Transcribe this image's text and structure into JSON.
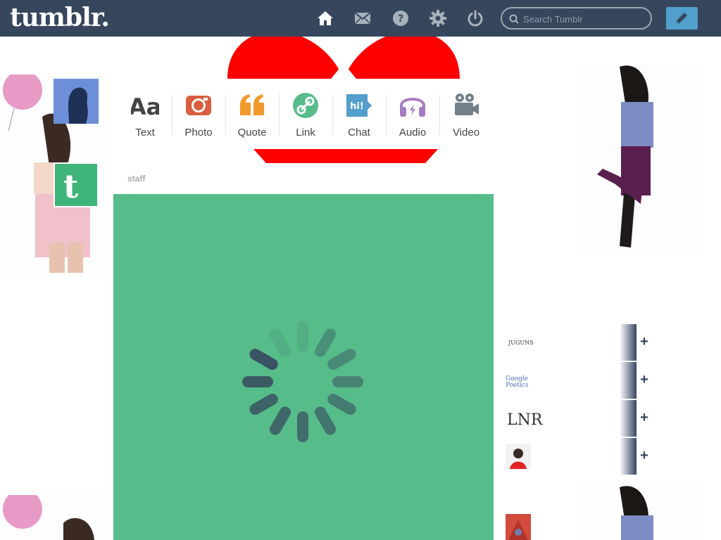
{
  "header": {
    "logo": "tumblr.",
    "search_placeholder": "Search Tumblr",
    "icons": [
      "home-icon",
      "mail-icon",
      "help-icon",
      "gear-icon",
      "power-icon"
    ],
    "compose_icon": "pencil-icon"
  },
  "post_types": [
    {
      "label": "Text",
      "icon": "text-icon",
      "color": "#444444"
    },
    {
      "label": "Photo",
      "icon": "camera-icon",
      "color": "#d95e40"
    },
    {
      "label": "Quote",
      "icon": "quote-icon",
      "color": "#f2992e"
    },
    {
      "label": "Link",
      "icon": "link-icon",
      "color": "#56bc8a"
    },
    {
      "label": "Chat",
      "icon": "chat-icon",
      "color": "#529ecc"
    },
    {
      "label": "Audio",
      "icon": "headphones-icon",
      "color": "#a77dc2"
    },
    {
      "label": "Video",
      "icon": "video-camera-icon",
      "color": "#748089"
    }
  ],
  "dashboard": {
    "post_author": "staff",
    "post_color": "#56bc8a"
  },
  "recommended": [
    {
      "thumb_text": "JUGUNS",
      "icon": "blog-avatar"
    },
    {
      "thumb_text": "Google Poetics",
      "icon": "blog-avatar"
    },
    {
      "thumb_text": "LNR",
      "icon": "blog-avatar"
    },
    {
      "thumb_text": "",
      "icon": "blog-avatar"
    }
  ],
  "colors": {
    "header_bg": "#36465d",
    "compose": "#529ecc",
    "heart": "#ff0000"
  }
}
